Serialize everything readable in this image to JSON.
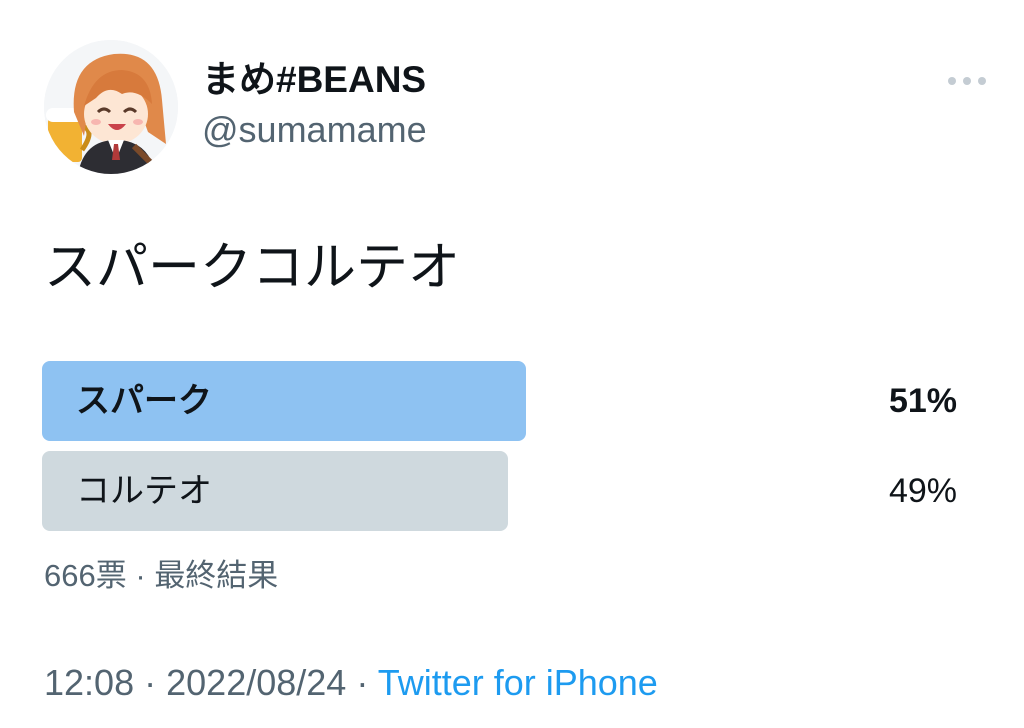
{
  "author": {
    "display_name": "まめ#BEANS",
    "handle": "@sumamame"
  },
  "tweet": {
    "text": "スパークコルテオ"
  },
  "poll": {
    "options": [
      {
        "label": "スパーク",
        "percent_text": "51%",
        "percent": 51,
        "winner": true
      },
      {
        "label": "コルテオ",
        "percent_text": "49%",
        "percent": 49,
        "winner": false
      }
    ],
    "votes": "666票",
    "separator": "·",
    "status": "最終結果"
  },
  "footer": {
    "time": "12:08",
    "date": "2022/08/24",
    "separator": "·",
    "source": "Twitter for iPhone"
  },
  "icons": {
    "more": "more-horizontal-icon"
  },
  "colors": {
    "winner_bar": "#8ec2f2",
    "other_bar": "#cfd9de",
    "link": "#1d9bf0",
    "secondary_text": "#536471"
  }
}
